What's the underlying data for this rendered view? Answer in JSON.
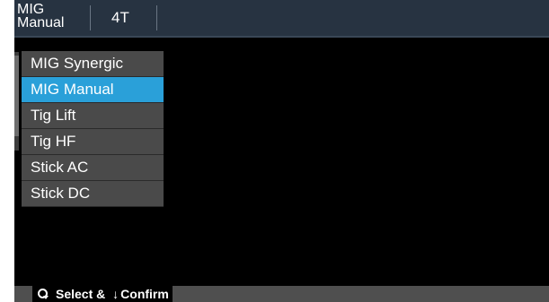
{
  "header": {
    "mode_line1": "MIG",
    "mode_line2": "Manual",
    "trigger_mode": "4T"
  },
  "menu": {
    "items": [
      {
        "label": "MIG Synergic",
        "selected": false
      },
      {
        "label": "MIG Manual",
        "selected": true
      },
      {
        "label": "Tig Lift",
        "selected": false
      },
      {
        "label": "Tig HF",
        "selected": false
      },
      {
        "label": "Stick AC",
        "selected": false
      },
      {
        "label": "Stick DC",
        "selected": false
      }
    ]
  },
  "footer": {
    "select_label": "Select",
    "connector": "&",
    "confirm_label": "Confirm",
    "knob_icon": "rotary-knob-icon",
    "confirm_icon": "down-arrow-icon"
  },
  "colors": {
    "header_bg": "#273341",
    "selected_bg": "#2aa0d9",
    "item_bg": "#4a4a4a",
    "screen_bg": "#000000"
  }
}
